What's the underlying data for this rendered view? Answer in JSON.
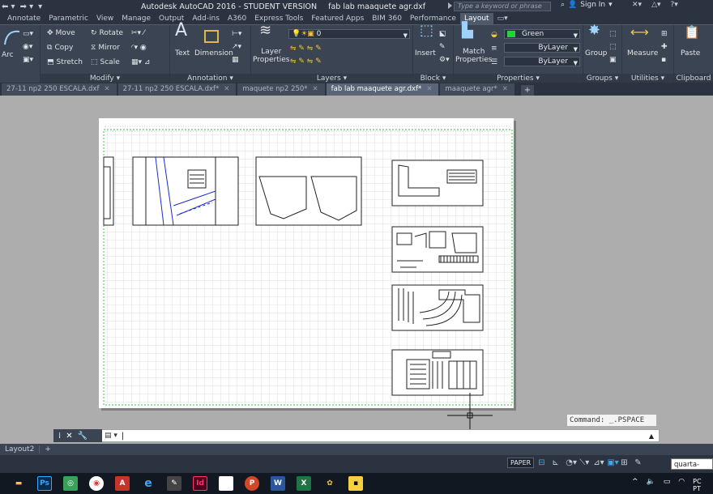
{
  "window": {
    "title": "Autodesk AutoCAD 2016 - STUDENT VERSION",
    "file": "fab lab maaquete agr.dxf"
  },
  "search": {
    "placeholder": "Type a keyword or phrase"
  },
  "account": {
    "signin": "Sign In"
  },
  "menu_tabs": [
    "Annotate",
    "Parametric",
    "View",
    "Manage",
    "Output",
    "Add-ins",
    "A360",
    "Express Tools",
    "Featured Apps",
    "BIM 360",
    "Performance",
    "Layout"
  ],
  "active_tab": "Layout",
  "ribbon": {
    "draw": {
      "arc": "Arc"
    },
    "modify": {
      "title": "Modify",
      "move": "Move",
      "rotate": "Rotate",
      "copy": "Copy",
      "mirror": "Mirror",
      "stretch": "Stretch",
      "scale": "Scale"
    },
    "annotation": {
      "title": "Annotation",
      "text": "Text",
      "dimension": "Dimension"
    },
    "layers": {
      "title": "Layers",
      "layer_properties_1": "Layer",
      "layer_properties_2": "Properties",
      "current_layer": "0"
    },
    "block": {
      "title": "Block",
      "insert": "Insert"
    },
    "properties": {
      "title": "Properties",
      "match_1": "Match",
      "match_2": "Properties",
      "color": "Green",
      "linetype": "ByLayer",
      "lineweight": "ByLayer"
    },
    "groups": {
      "title": "Groups",
      "group": "Group"
    },
    "utilities": {
      "title": "Utilities",
      "measure": "Measure"
    },
    "clipboard": {
      "title": "Clipboard",
      "paste": "Paste"
    }
  },
  "doc_tabs": [
    {
      "label": "27-11 np2 250 ESCALA.dxf",
      "active": false
    },
    {
      "label": "27-11 np2 250 ESCALA.dxf*",
      "active": false
    },
    {
      "label": "maquete np2 250*",
      "active": false
    },
    {
      "label": "fab lab maaquete agr.dxf*",
      "active": true
    },
    {
      "label": "maaquete agr*",
      "active": false
    }
  ],
  "command": {
    "history": "Command: _.PSPACE",
    "prompt": ""
  },
  "layout_tabs": {
    "current": "Layout2"
  },
  "status": {
    "space": "PAPER"
  },
  "tooltip": "quarta-feira",
  "tray": {
    "lang1": "PC",
    "lang2": "PT"
  },
  "taskbar_apps": [
    "file-explorer",
    "photoshop",
    "scanner",
    "chrome",
    "autocad",
    "edge",
    "inkscape",
    "indesign",
    "notepad",
    "powerpoint",
    "word",
    "excel",
    "paint-3d",
    "sticky-notes"
  ],
  "colors": {
    "ribbon": "#3b4452",
    "titlebar": "#2b3340",
    "canvas": "#adadad",
    "accent_green": "#2ecc40",
    "grid": "#d5d5d5"
  }
}
